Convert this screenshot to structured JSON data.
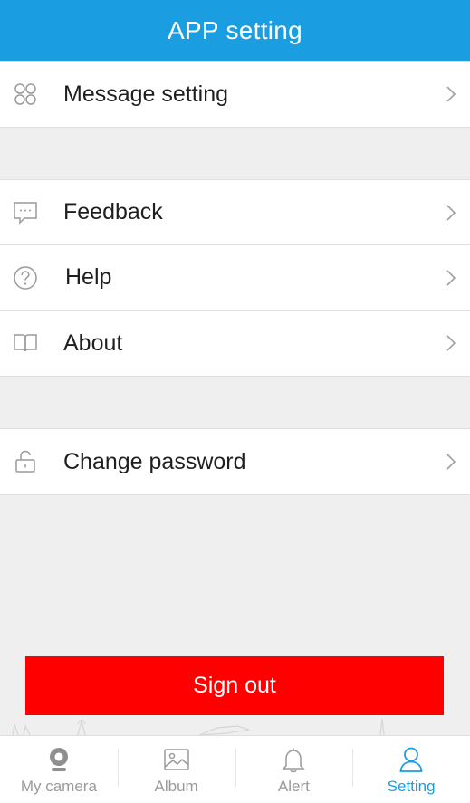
{
  "header": {
    "title": "APP setting"
  },
  "groups": [
    {
      "items": [
        {
          "label": "Message setting",
          "icon": "grid-icon"
        }
      ]
    },
    {
      "items": [
        {
          "label": "Feedback",
          "icon": "message-bubble-icon"
        },
        {
          "label": "Help",
          "icon": "question-circle-icon"
        },
        {
          "label": "About",
          "icon": "book-icon"
        }
      ]
    },
    {
      "items": [
        {
          "label": "Change password",
          "icon": "lock-icon"
        }
      ]
    }
  ],
  "signout": {
    "label": "Sign out"
  },
  "tabbar": {
    "tabs": [
      {
        "label": "My camera",
        "icon": "camera-icon",
        "active": false
      },
      {
        "label": "Album",
        "icon": "image-icon",
        "active": false
      },
      {
        "label": "Alert",
        "icon": "bell-icon",
        "active": false
      },
      {
        "label": "Setting",
        "icon": "user-icon",
        "active": true
      }
    ]
  },
  "colors": {
    "header": "#1a9ee1",
    "accent": "#1a9ee1",
    "signout": "#ff0000",
    "background": "#efefef",
    "inactive_tab": "#9a9a9a"
  }
}
